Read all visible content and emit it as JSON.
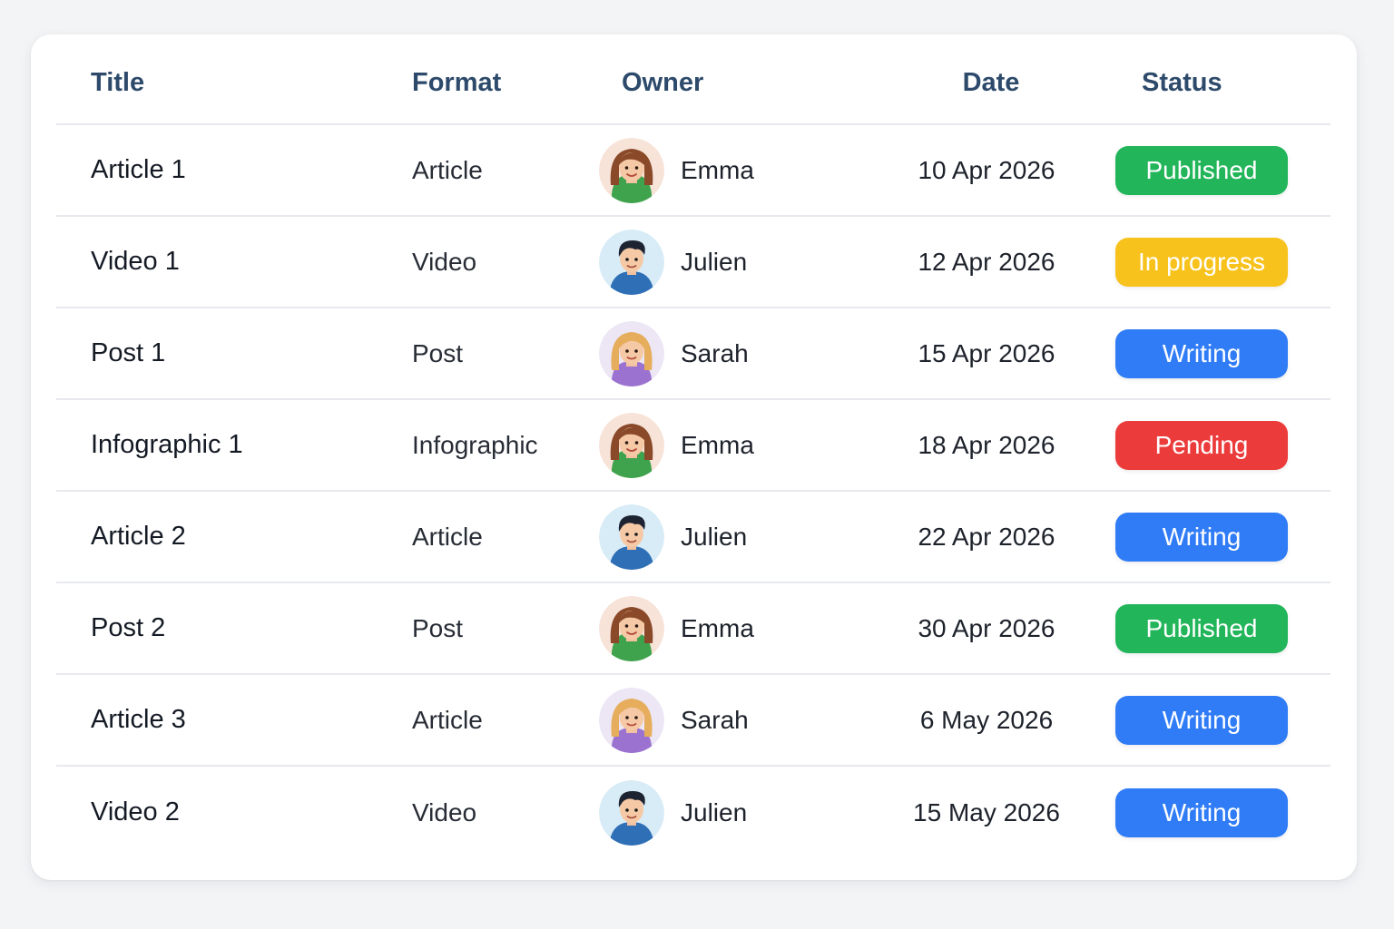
{
  "table": {
    "headers": {
      "title": "Title",
      "format": "Format",
      "owner": "Owner",
      "date": "Date",
      "status": "Status"
    },
    "rows": [
      {
        "title": "Article 1",
        "format": "Article",
        "owner": "Emma",
        "avatar": "woman-brown-hair-avatar",
        "date": "10 Apr 2026",
        "status": "Published",
        "status_color": "#22b55a"
      },
      {
        "title": "Video 1",
        "format": "Video",
        "owner": "Julien",
        "avatar": "man-dark-hair-avatar",
        "date": "12 Apr 2026",
        "status": "In progress",
        "status_color": "#f8c21c"
      },
      {
        "title": "Post 1",
        "format": "Post",
        "owner": "Sarah",
        "avatar": "woman-blonde-hair-avatar",
        "date": "15 Apr 2026",
        "status": "Writing",
        "status_color": "#2f7cf6"
      },
      {
        "title": "Infographic 1",
        "format": "Infographic",
        "owner": "Emma",
        "avatar": "woman-brown-hair-avatar",
        "date": "18 Apr 2026",
        "status": "Pending",
        "status_color": "#ec3b3b"
      },
      {
        "title": "Article 2",
        "format": "Article",
        "owner": "Julien",
        "avatar": "man-dark-hair-avatar",
        "date": "22 Apr 2026",
        "status": "Writing",
        "status_color": "#2f7cf6"
      },
      {
        "title": "Post 2",
        "format": "Post",
        "owner": "Emma",
        "avatar": "woman-brown-hair-avatar",
        "date": "30 Apr 2026",
        "status": "Published",
        "status_color": "#22b55a"
      },
      {
        "title": "Article 3",
        "format": "Article",
        "owner": "Sarah",
        "avatar": "woman-blonde-hair-avatar",
        "date": "6 May 2026",
        "status": "Writing",
        "status_color": "#2f7cf6"
      },
      {
        "title": "Video 2",
        "format": "Video",
        "owner": "Julien",
        "avatar": "man-dark-hair-avatar",
        "date": "15 May 2026",
        "status": "Writing",
        "status_color": "#2f7cf6"
      }
    ]
  }
}
